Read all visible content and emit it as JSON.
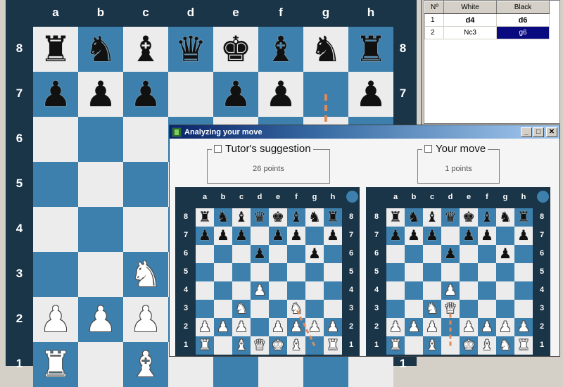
{
  "main_board": {
    "files": [
      "a",
      "b",
      "c",
      "d",
      "e",
      "f",
      "g",
      "h"
    ],
    "ranks": [
      "8",
      "7",
      "6",
      "5",
      "4",
      "3",
      "2",
      "1"
    ],
    "position": [
      [
        "r",
        "n",
        "b",
        "q",
        "k",
        "b",
        "n",
        "r"
      ],
      [
        "p",
        "p",
        "p",
        "",
        "p",
        "p",
        "",
        "p"
      ],
      [
        "",
        "",
        "",
        "",
        "",
        "",
        "",
        ""
      ],
      [
        "",
        "",
        "",
        "",
        "",
        "",
        "",
        ""
      ],
      [
        "",
        "",
        "",
        "",
        "",
        "",
        "",
        ""
      ],
      [
        "",
        "",
        "N",
        "",
        "",
        "",
        "",
        ""
      ],
      [
        "P",
        "P",
        "P",
        "",
        "",
        "",
        "",
        ""
      ],
      [
        "R",
        "",
        "B",
        "",
        "",
        "",
        "",
        ""
      ]
    ],
    "hint_arrow": {
      "from": "g7",
      "to": "g6",
      "color": "#e08a5c"
    }
  },
  "move_list": {
    "headers": {
      "no": "Nº",
      "white": "White",
      "black": "Black"
    },
    "rows": [
      {
        "no": "1",
        "white": "d4",
        "black": "d6",
        "bold": true
      },
      {
        "no": "2",
        "white": "Nc3",
        "black": "g6",
        "selected": "black"
      }
    ]
  },
  "dialog": {
    "title": "Analyzing your move",
    "buttons": {
      "minimize": "_",
      "maximize": "□",
      "close": "✕"
    },
    "tutor": {
      "label": "Tutor's suggestion",
      "points": "26 points",
      "checked": false
    },
    "yours": {
      "label": "Your move",
      "points": "1 points",
      "checked": false
    },
    "boards": [
      {
        "name": "tutor-board",
        "position": [
          [
            "r",
            "n",
            "b",
            "q",
            "k",
            "b",
            "n",
            "r"
          ],
          [
            "p",
            "p",
            "p",
            "",
            "p",
            "p",
            "",
            "p"
          ],
          [
            "",
            "",
            "",
            "p",
            "",
            "",
            "p",
            ""
          ],
          [
            "",
            "",
            "",
            "",
            "",
            "",
            "",
            ""
          ],
          [
            "",
            "",
            "",
            "P",
            "",
            "",
            "",
            ""
          ],
          [
            "",
            "",
            "N",
            "",
            "",
            "N",
            "",
            ""
          ],
          [
            "P",
            "P",
            "P",
            "",
            "P",
            "P",
            "P",
            "P"
          ],
          [
            "R",
            "",
            "B",
            "Q",
            "K",
            "B",
            "",
            "R"
          ]
        ],
        "arrow": {
          "from": "g1",
          "to": "f3"
        }
      },
      {
        "name": "your-move-board",
        "position": [
          [
            "r",
            "n",
            "b",
            "q",
            "k",
            "b",
            "n",
            "r"
          ],
          [
            "p",
            "p",
            "p",
            "",
            "p",
            "p",
            "",
            "p"
          ],
          [
            "",
            "",
            "",
            "p",
            "",
            "",
            "p",
            ""
          ],
          [
            "",
            "",
            "",
            "",
            "",
            "",
            "",
            ""
          ],
          [
            "",
            "",
            "",
            "P",
            "",
            "",
            "",
            ""
          ],
          [
            "",
            "",
            "N",
            "Q",
            "",
            "",
            "",
            ""
          ],
          [
            "P",
            "P",
            "P",
            "",
            "P",
            "P",
            "P",
            "P"
          ],
          [
            "R",
            "",
            "B",
            "",
            "K",
            "B",
            "N",
            "R"
          ]
        ],
        "arrow": {
          "from": "d1",
          "to": "d3"
        }
      }
    ]
  },
  "colors": {
    "light_square": "#ececec",
    "dark_square": "#3d80ad",
    "frame": "#1a3448",
    "selection": "#0a0a80"
  }
}
